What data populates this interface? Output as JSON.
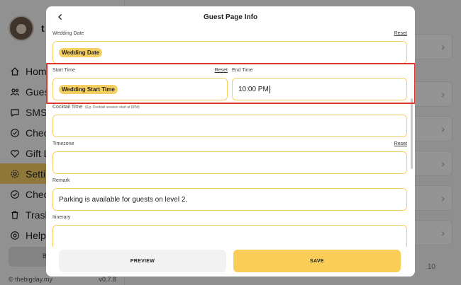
{
  "background": {
    "profile_initial": "t",
    "nav": [
      {
        "label": "Home",
        "icon": "home-icon"
      },
      {
        "label": "Guest",
        "icon": "guests-icon"
      },
      {
        "label": "SMS",
        "icon": "chat-icon"
      },
      {
        "label": "Check",
        "icon": "check-badge-icon"
      },
      {
        "label": "Gift Lo",
        "icon": "heart-icon"
      },
      {
        "label": "Settin",
        "icon": "settings-icon",
        "active": true
      },
      {
        "label": "Check",
        "icon": "check-circle-icon"
      },
      {
        "label": "Trash",
        "icon": "trash-icon"
      },
      {
        "label": "Help",
        "icon": "help-icon"
      }
    ],
    "sidebar_button_label": "B",
    "footer_brand": "© thebigday.my",
    "footer_version": "v0.7.8",
    "row_number": "10",
    "accent_color": "#f6cf63"
  },
  "modal": {
    "title": "Guest Page Info",
    "back_icon": "chevron-left-icon",
    "fields": {
      "wedding_date": {
        "label": "Wedding Date",
        "reset": "Reset",
        "tag": "Wedding Date"
      },
      "start_time": {
        "label": "Start Time",
        "reset": "Reset",
        "tag": "Wedding Start Time"
      },
      "end_time": {
        "label": "End Time",
        "value": "10:00 PM"
      },
      "cocktail_time": {
        "label": "Cocktail Time",
        "hint": "(Eg. Cocktail session start at 6PM)",
        "value": ""
      },
      "timezone": {
        "label": "Timezone",
        "reset": "Reset",
        "value": ""
      },
      "remark": {
        "label": "Remark",
        "value": "Parking is available for guests on level 2."
      },
      "itinerary": {
        "label": "Itinerary",
        "value": ""
      }
    },
    "buttons": {
      "preview": "PREVIEW",
      "save": "SAVE"
    },
    "highlight_color": "#e0372b"
  }
}
